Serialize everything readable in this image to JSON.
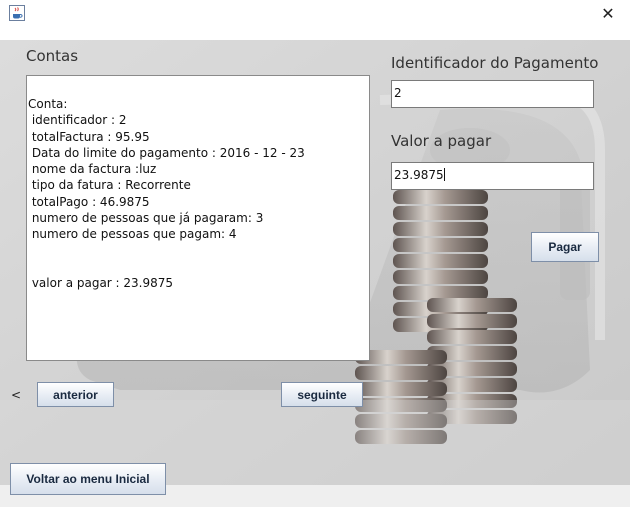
{
  "window": {
    "app_icon": "java-coffee-icon",
    "close_glyph": "✕"
  },
  "labels": {
    "contas": "Contas",
    "identificador": "Identificador do Pagamento",
    "valor": "Valor a pagar"
  },
  "account_text": "Conta:\n identificador : 2\n totalFactura : 95.95\n Data do limite do pagamento : 2016 - 12 - 23\n nome da factura :luz\n tipo da fatura : Recorrente\n totalPago : 46.9875\n numero de pessoas que já pagaram: 3\n numero de pessoas que pagam: 4\n\n\n valor a pagar : 23.9875",
  "fields": {
    "identificador_value": "2",
    "valor_value": "23.9875"
  },
  "buttons": {
    "pagar": "Pagar",
    "anterior": "anterior",
    "seguinte": "seguinte",
    "voltar": "Voltar ao menu Inicial"
  },
  "prev_glyph": "<",
  "colors": {
    "panel_bg": "#d6d6d6",
    "button_text": "#1a2a40",
    "button_border": "#7e8fa8"
  }
}
